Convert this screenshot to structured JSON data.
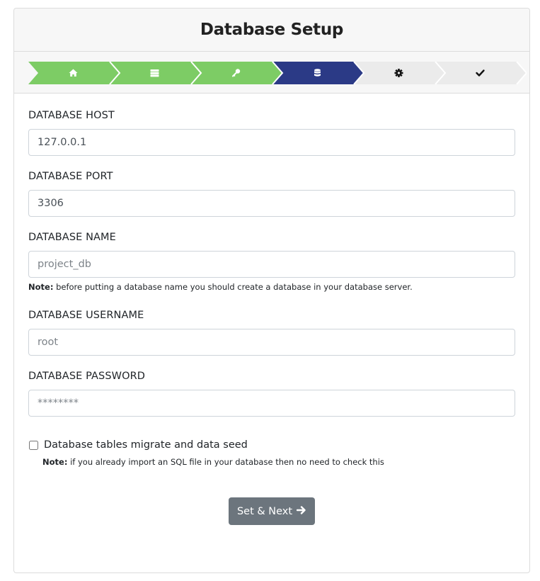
{
  "header": {
    "title": "Database Setup"
  },
  "stepper": {
    "steps": [
      {
        "icon": "home-icon",
        "state": "done"
      },
      {
        "icon": "server-icon",
        "state": "done"
      },
      {
        "icon": "key-icon",
        "state": "done"
      },
      {
        "icon": "database-icon",
        "state": "active"
      },
      {
        "icon": "gear-icon",
        "state": "pending"
      },
      {
        "icon": "check-icon",
        "state": "pending"
      }
    ],
    "colors": {
      "done": "#7dcc65",
      "active": "#2b3a86",
      "pending": "#ebebeb"
    }
  },
  "form": {
    "host": {
      "label": "DATABASE HOST",
      "value": "127.0.0.1",
      "placeholder": ""
    },
    "port": {
      "label": "DATABASE PORT",
      "value": "3306",
      "placeholder": ""
    },
    "name": {
      "label": "DATABASE NAME",
      "value": "",
      "placeholder": "project_db",
      "note_label": "Note:",
      "note_text": " before putting a database name you should create a database in your database server."
    },
    "username": {
      "label": "DATABASE USERNAME",
      "value": "",
      "placeholder": "root"
    },
    "password": {
      "label": "DATABASE PASSWORD",
      "value": "",
      "placeholder": "********"
    },
    "migrate": {
      "label": "Database tables migrate and data seed",
      "checked": false,
      "note_label": "Note:",
      "note_text": " if you already import an SQL file in your database then no need to check this"
    }
  },
  "submit": {
    "label": "Set & Next"
  }
}
